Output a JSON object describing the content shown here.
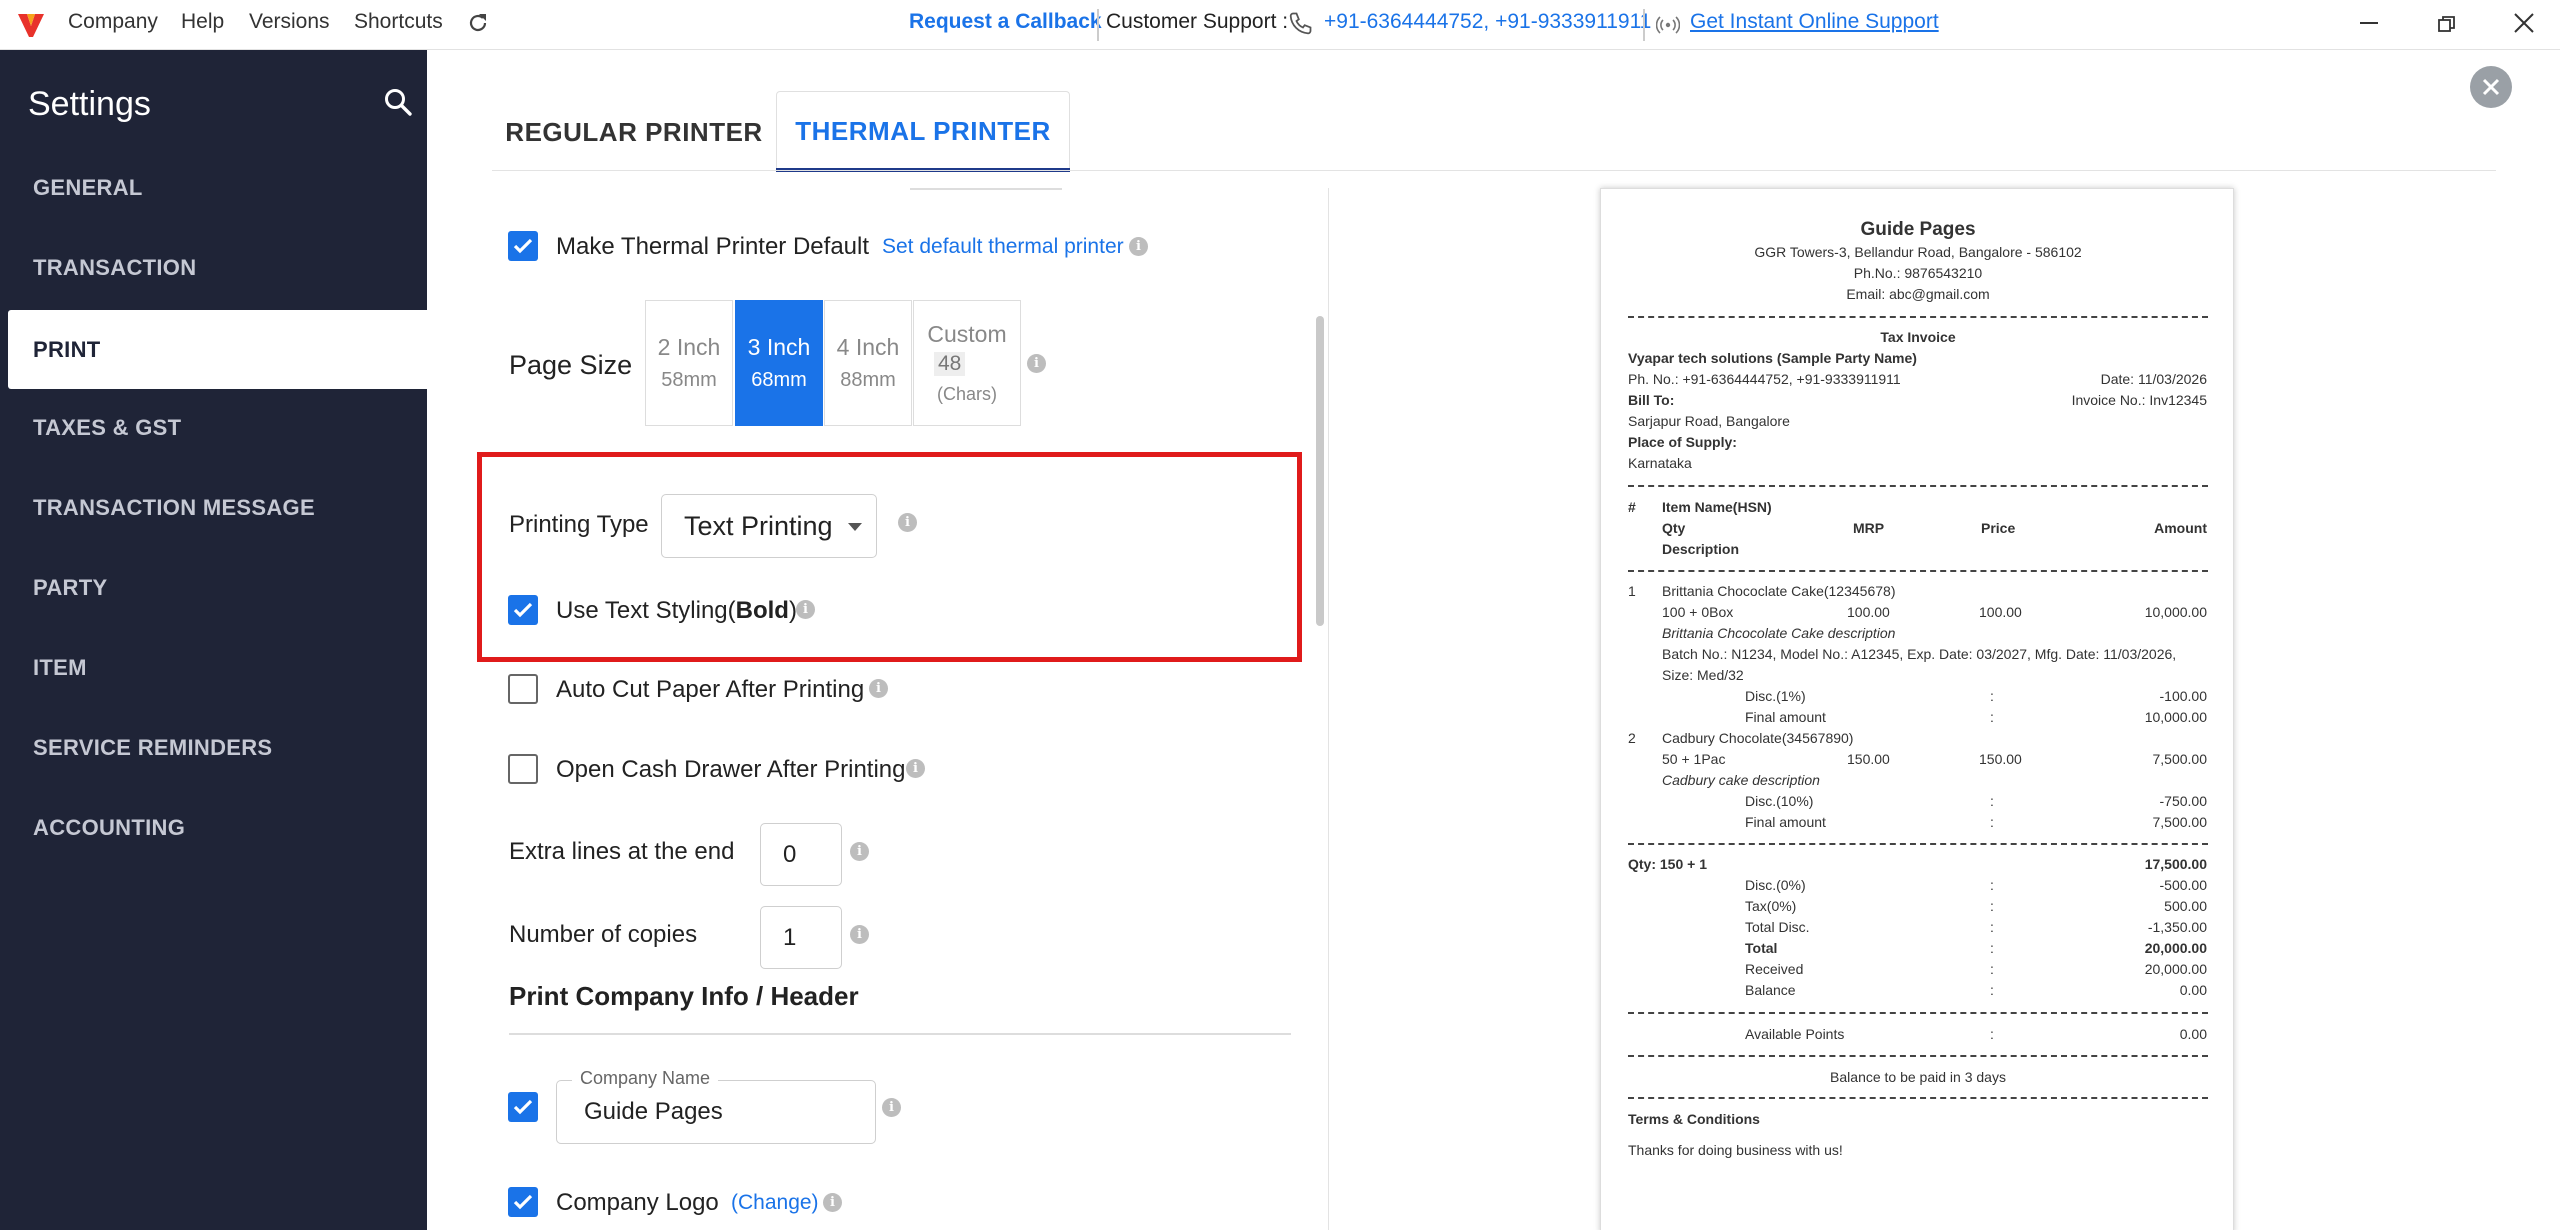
{
  "topbar": {
    "menu": [
      "Company",
      "Help",
      "Versions",
      "Shortcuts"
    ],
    "callback": "Request a Callback",
    "support_label": "Customer Support :",
    "phones": "+91-6364444752, +91-9333911911",
    "online_support": "Get Instant Online Support"
  },
  "sidebar": {
    "title": "Settings",
    "items": [
      "GENERAL",
      "TRANSACTION",
      "PRINT",
      "TAXES & GST",
      "TRANSACTION MESSAGE",
      "PARTY",
      "ITEM",
      "SERVICE REMINDERS",
      "ACCOUNTING"
    ],
    "active": "PRINT"
  },
  "tabs": {
    "regular": "REGULAR PRINTER",
    "thermal": "THERMAL PRINTER"
  },
  "settings": {
    "make_default": "Make Thermal Printer Default",
    "set_default_link": "Set default thermal printer",
    "page_size_label": "Page Size",
    "page_sizes": [
      {
        "name": "2 Inch",
        "sub": "58mm"
      },
      {
        "name": "3 Inch",
        "sub": "68mm"
      },
      {
        "name": "4 Inch",
        "sub": "88mm"
      },
      {
        "name": "Custom",
        "value": "48",
        "sub": "(Chars)"
      }
    ],
    "printing_type_label": "Printing Type",
    "printing_type_value": "Text Printing",
    "text_styling": "Use Text Styling(",
    "text_styling_bold": "Bold",
    "text_styling_end": ")",
    "auto_cut": "Auto Cut Paper After Printing",
    "cash_drawer": "Open Cash Drawer After Printing",
    "extra_lines_label": "Extra lines at the end",
    "extra_lines_value": "0",
    "copies_label": "Number of copies",
    "copies_value": "1",
    "header_section": "Print Company Info / Header",
    "company_name_label": "Company Name",
    "company_name_value": "Guide Pages",
    "company_logo": "Company Logo",
    "change_link": "(Change)"
  },
  "receipt": {
    "company": "Guide Pages",
    "address": "GGR Towers-3, Bellandur Road, Bangalore - 586102",
    "phone": "Ph.No.: 9876543210",
    "email": "Email: abc@gmail.com",
    "doc_title": "Tax Invoice",
    "party": "Vyapar tech solutions (Sample Party Name)",
    "party_phone": "Ph. No.: +91-6364444752, +91-9333911911",
    "date": "Date: 11/03/2026",
    "bill_to": "Bill To:",
    "invoice_no": "Invoice No.: Inv12345",
    "bill_addr": "Sarjapur Road, Bangalore",
    "place_label": "Place of Supply:",
    "place": "Karnataka",
    "col_hash": "#",
    "col_item": "Item Name(HSN)",
    "col_qty": "Qty",
    "col_mrp": "MRP",
    "col_price": "Price",
    "col_amount": "Amount",
    "col_desc": "Description",
    "item1": {
      "no": "1",
      "name": "Brittania Chococlate Cake(12345678)",
      "qty": "100 + 0Box",
      "mrp": "100.00",
      "price": "100.00",
      "amount": "10,000.00",
      "desc": "Brittania Chcocolate Cake description",
      "batch1": "Batch No.: N1234, Model No.: A12345, Exp. Date: 03/2027, Mfg. Date: 11/03/2026,",
      "batch2": "Size: Med/32",
      "disc_label": "Disc.(1%)",
      "disc": "-100.00",
      "final_label": "Final amount",
      "final": "10,000.00"
    },
    "item2": {
      "no": "2",
      "name": "Cadbury Chocolate(34567890)",
      "qty": "50 + 1Pac",
      "mrp": "150.00",
      "price": "150.00",
      "amount": "7,500.00",
      "desc": "Cadbury cake description",
      "disc_label": "Disc.(10%)",
      "disc": "-750.00",
      "final_label": "Final amount",
      "final": "7,500.00"
    },
    "colon": ":",
    "qty_total": "Qty: 150 + 1",
    "subtotal": "17,500.00",
    "totals": [
      {
        "label": "Disc.(0%)",
        "value": "-500.00",
        "bold": false
      },
      {
        "label": "Tax(0%)",
        "value": "500.00",
        "bold": false
      },
      {
        "label": "Total Disc.",
        "value": "-1,350.00",
        "bold": false
      },
      {
        "label": "Total",
        "value": "20,000.00",
        "bold": true
      },
      {
        "label": "Received",
        "value": "20,000.00",
        "bold": false
      },
      {
        "label": "Balance",
        "value": "0.00",
        "bold": false
      }
    ],
    "points_label": "Available Points",
    "points": "0.00",
    "balance_note": "Balance to be paid in 3 days",
    "terms_title": "Terms & Conditions",
    "terms": "Thanks for doing business with us!"
  },
  "colors": {
    "accent": "#1a73e8",
    "sidebar": "#1f2437",
    "highlight": "#e01b1b"
  }
}
